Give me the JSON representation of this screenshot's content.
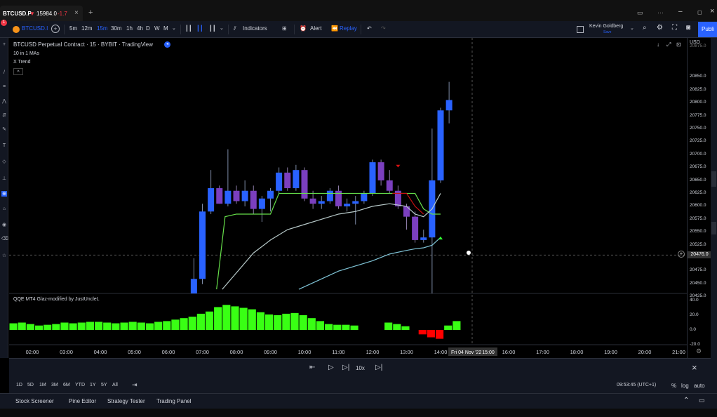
{
  "titlebar": {
    "tab_symbol": "BTCUSD.P",
    "tab_arrow": "▼",
    "tab_price": "15984.0",
    "tab_change": "-1.7",
    "tab_close": "×",
    "new_tab": "+",
    "window_min": "–",
    "window_max": "◻",
    "window_close": "×"
  },
  "toolbar": {
    "symbol": "BTCUSD.I",
    "notify_badge": "1",
    "intervals": [
      "5m",
      "12m",
      "15m",
      "30m",
      "1h",
      "4h",
      "D",
      "W",
      "M"
    ],
    "active_interval": "15m",
    "indicators_label": "Indicators",
    "alert_label": "Alert",
    "replay_label": "Replay",
    "user_name": "Kevin Goldberg",
    "user_sub": "Save",
    "publish_label": "Publi"
  },
  "legend": {
    "title": "BTCUSD Perpetual Contract · 15 · BYBIT · TradingView",
    "ma_label": "10 in 1 MAs",
    "trend_label": "X Trend",
    "collapse": "^"
  },
  "indicator": {
    "title": "QQE MT4 Glaz-modified by JustUncleL"
  },
  "price_axis": {
    "currency": "USD",
    "labels": [
      "20875.0",
      "20850.0",
      "20825.0",
      "20800.0",
      "20775.0",
      "20750.0",
      "20725.0",
      "20700.0",
      "20675.0",
      "20650.0",
      "20625.0",
      "20600.0",
      "20575.0",
      "20550.0",
      "20525.0",
      "20500.0",
      "20475.0",
      "20450.0",
      "20425.0"
    ],
    "current_price": "20476.0",
    "ind_labels": [
      "40.0",
      "20.0",
      "0.0",
      "-20.0"
    ]
  },
  "time_axis": {
    "labels": [
      "02:00",
      "03:00",
      "04:00",
      "05:00",
      "06:00",
      "07:00",
      "08:00",
      "09:00",
      "10:00",
      "11:00",
      "12:00",
      "13:00",
      "14:00",
      "15:00",
      "16:00",
      "17:00",
      "18:00",
      "19:00",
      "20:00",
      "21:00"
    ],
    "cursor_date": "Fri 04 Nov '22",
    "cursor_time": "15:00"
  },
  "replay": {
    "speed": "10x"
  },
  "ranges": {
    "items": [
      "1D",
      "5D",
      "1M",
      "3M",
      "6M",
      "YTD",
      "1Y",
      "5Y",
      "All"
    ],
    "clock": "09:53:45 (UTC+1)",
    "percent": "%",
    "log": "log",
    "auto": "auto"
  },
  "bottom_tabs": [
    "Stock Screener",
    "Pine Editor",
    "Strategy Tester",
    "Trading Panel"
  ],
  "colors": {
    "bull": "#2962ff",
    "bear": "#7b3fbf",
    "qqe_pos": "#39ff14",
    "qqe_neg": "#ff0000",
    "ma_green": "#66e04a",
    "ma_white": "#b7c9c9",
    "ma_blue": "#7fc3d6",
    "trend_red": "#cc1111",
    "accent": "#2962ff"
  },
  "chart_data": {
    "type": "candlestick",
    "symbol": "BTCUSD Perpetual Contract",
    "interval": "15",
    "exchange": "BYBIT",
    "candles": [
      {
        "time": "06:45",
        "open": 20390,
        "high": 20470,
        "low": 20380,
        "close": 20430
      },
      {
        "time": "07:00",
        "open": 20430,
        "high": 20575,
        "low": 20420,
        "close": 20560
      },
      {
        "time": "07:15",
        "open": 20560,
        "high": 20640,
        "low": 20555,
        "close": 20605
      },
      {
        "time": "07:30",
        "open": 20605,
        "high": 20610,
        "low": 20575,
        "close": 20575
      },
      {
        "time": "07:45",
        "open": 20575,
        "high": 20680,
        "low": 20570,
        "close": 20600
      },
      {
        "time": "08:00",
        "open": 20600,
        "high": 20610,
        "low": 20575,
        "close": 20580
      },
      {
        "time": "08:15",
        "open": 20580,
        "high": 20620,
        "low": 20570,
        "close": 20600
      },
      {
        "time": "08:30",
        "open": 20600,
        "high": 20610,
        "low": 20555,
        "close": 20565
      },
      {
        "time": "08:45",
        "open": 20565,
        "high": 20590,
        "low": 20540,
        "close": 20585
      },
      {
        "time": "09:00",
        "open": 20585,
        "high": 20605,
        "low": 20560,
        "close": 20600
      },
      {
        "time": "09:15",
        "open": 20600,
        "high": 20645,
        "low": 20595,
        "close": 20635
      },
      {
        "time": "09:30",
        "open": 20635,
        "high": 20645,
        "low": 20600,
        "close": 20605
      },
      {
        "time": "09:45",
        "open": 20605,
        "high": 20650,
        "low": 20600,
        "close": 20640
      },
      {
        "time": "10:00",
        "open": 20640,
        "high": 20645,
        "low": 20580,
        "close": 20585
      },
      {
        "time": "10:15",
        "open": 20585,
        "high": 20600,
        "low": 20565,
        "close": 20575
      },
      {
        "time": "10:30",
        "open": 20575,
        "high": 20590,
        "low": 20565,
        "close": 20580
      },
      {
        "time": "10:45",
        "open": 20580,
        "high": 20605,
        "low": 20575,
        "close": 20600
      },
      {
        "time": "11:00",
        "open": 20600,
        "high": 20610,
        "low": 20565,
        "close": 20570
      },
      {
        "time": "11:15",
        "open": 20570,
        "high": 20585,
        "low": 20560,
        "close": 20575
      },
      {
        "time": "11:30",
        "open": 20575,
        "high": 20590,
        "low": 20535,
        "close": 20580
      },
      {
        "time": "11:45",
        "open": 20580,
        "high": 20600,
        "low": 20575,
        "close": 20595
      },
      {
        "time": "12:00",
        "open": 20595,
        "high": 20660,
        "low": 20590,
        "close": 20655
      },
      {
        "time": "12:15",
        "open": 20655,
        "high": 20660,
        "low": 20610,
        "close": 20620
      },
      {
        "time": "12:30",
        "open": 20620,
        "high": 20640,
        "low": 20595,
        "close": 20600
      },
      {
        "time": "12:45",
        "open": 20600,
        "high": 20610,
        "low": 20565,
        "close": 20570
      },
      {
        "time": "13:00",
        "open": 20570,
        "high": 20575,
        "low": 20525,
        "close": 20550
      },
      {
        "time": "13:15",
        "open": 20550,
        "high": 20560,
        "low": 20500,
        "close": 20505
      },
      {
        "time": "13:30",
        "open": 20505,
        "high": 20525,
        "low": 20500,
        "close": 20510
      },
      {
        "time": "13:45",
        "open": 20510,
        "high": 20720,
        "low": 20400,
        "close": 20620
      },
      {
        "time": "14:00",
        "open": 20620,
        "high": 20760,
        "low": 20615,
        "close": 20755
      },
      {
        "time": "14:15",
        "open": 20755,
        "high": 20810,
        "low": 20730,
        "close": 20775
      }
    ],
    "qqe_histogram": [
      9,
      10,
      8,
      6,
      7,
      8,
      10,
      9,
      10,
      11,
      11,
      10,
      9,
      10,
      11,
      10,
      9,
      11,
      12,
      14,
      16,
      18,
      22,
      25,
      31,
      34,
      32,
      30,
      28,
      24,
      21,
      20,
      22,
      23,
      20,
      16,
      12,
      8,
      7,
      7,
      6,
      0,
      0,
      0,
      10,
      8,
      5,
      0,
      -6,
      -10,
      -12,
      6,
      12
    ],
    "ylim": [
      20410,
      20880
    ],
    "ind_ylim": [
      -25,
      42
    ]
  }
}
